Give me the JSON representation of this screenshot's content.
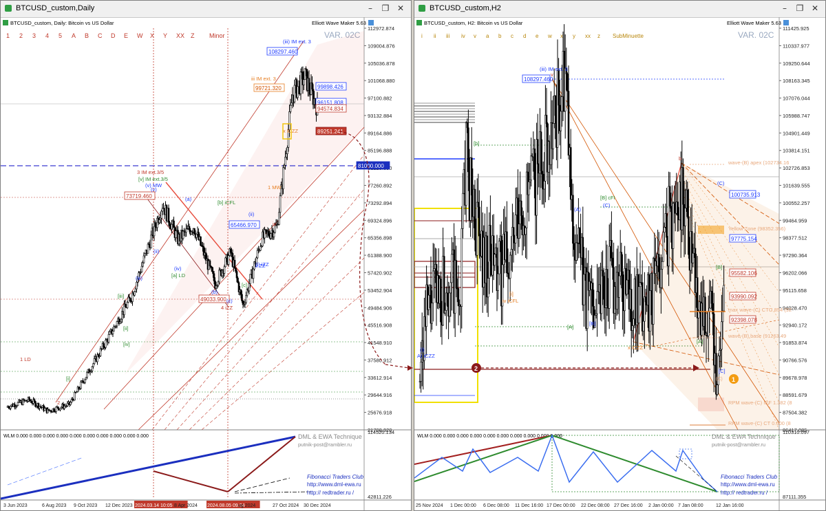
{
  "left": {
    "title": "BTCUSD_custom,Daily",
    "header": "BTCUSD_custom, Daily:  Bitcoin vs US Dollar",
    "plugin": "Elliott Wave Maker 5.63",
    "var_label": "VAR. 02C",
    "degree_labels": [
      "1",
      "2",
      "3",
      "4",
      "5",
      "A",
      "B",
      "C",
      "D",
      "E",
      "W",
      "X",
      "Y",
      "XX",
      "Z"
    ],
    "degree_name": "Minor",
    "price_scale": [
      "112972.874",
      "109004.876",
      "105036.878",
      "101068.880",
      "97100.882",
      "93132.884",
      "89164.886",
      "85196.888",
      "81228.890",
      "77260.892",
      "73292.894",
      "69324.896",
      "65356.898",
      "61388.900",
      "57420.902",
      "53452.904",
      "49484.906",
      "45516.908",
      "41548.910",
      "37580.912",
      "33612.914",
      "29644.916",
      "25676.918",
      "21708.920"
    ],
    "time_axis": [
      "3 Jun 2023",
      "6 Aug 2023",
      "9 Oct 2023",
      "12 Dec 2023",
      "2024.03.14 10:05",
      "8 Apr 2024",
      "2024.08.05 09:24",
      "ug 2024",
      "27 Oct 2024",
      "30 Dec 2024"
    ],
    "price_tags": [
      {
        "text": "108297.460",
        "style": "blue"
      },
      {
        "text": "99721.320",
        "style": "orange"
      },
      {
        "text": "99898.426",
        "style": "blue"
      },
      {
        "text": "96151.808",
        "style": "blue"
      },
      {
        "text": "94574.834",
        "style": "red"
      },
      {
        "text": "89251.241",
        "style": "redfill"
      },
      {
        "text": "81000.000",
        "style": "bluefill"
      },
      {
        "text": "73719.460",
        "style": "red"
      },
      {
        "text": "65466.970",
        "style": "blue"
      },
      {
        "text": "49033.900",
        "style": "red"
      }
    ],
    "wave_labels": [
      "(iii) IM ext. 3",
      "iii IM ext. 3",
      "3 IM ext.3/5",
      "[v] IM ext.3/5",
      "(v) MW",
      "[a] LD",
      "4 iZZ",
      "1 LD",
      "2",
      "[iv]",
      "[iii]",
      "[ii]",
      "(iii)",
      "(v)",
      "(ii)",
      "(iv)",
      "(a)",
      "(b)",
      "(c)",
      "[b] iCFL",
      "(ii)",
      "ii ZZ",
      "(i) iZZ",
      "x iCZZ",
      "[c]",
      "[i]",
      "1 MW",
      "iv"
    ],
    "indicator": {
      "header": "WLM 0.000 0.000 0.000 0.000 0.000 0.000 0.000 0.000 0.000 0.000",
      "scale_top": "114520.134",
      "scale_bottom": "42811.226",
      "watermark": [
        "DML & EWA Technique",
        "putnik-post@rambler.ru",
        "Fibonacci Traders Club",
        "http://www.dml-ewa.ru",
        "http:// redtrader.ru /"
      ]
    },
    "markers": [
      "2"
    ]
  },
  "right": {
    "title": "BTCUSD_custom,H2",
    "header": "BTCUSD_custom, H2:  Bitcoin vs US Dollar",
    "plugin": "Elliott Wave Maker 5.63",
    "var_label": "VAR. 02C",
    "degree_labels": [
      "i",
      "ii",
      "iii",
      "iv",
      "v",
      "a",
      "b",
      "c",
      "d",
      "e",
      "w",
      "x",
      "y",
      "xx",
      "z"
    ],
    "degree_name": "SubMinuette",
    "price_scale": [
      "111425.925",
      "110337.977",
      "109250.644",
      "108163.345",
      "107076.044",
      "105988.747",
      "104901.449",
      "103814.151",
      "102726.853",
      "101639.555",
      "100552.257",
      "99464.959",
      "98377.512",
      "97290.364",
      "96202.066",
      "95115.658",
      "94028.470",
      "92940.172",
      "91853.874",
      "90766.576",
      "89678.978",
      "88591.679",
      "87504.382",
      "86417.085"
    ],
    "time_axis": [
      "25 Nov 2024",
      "1 Dec 00:00",
      "6 Dec 08:00",
      "11 Dec 16:00",
      "17 Dec 00:00",
      "22 Dec 08:00",
      "27 Dec 16:00",
      "2 Jan 00:00",
      "7 Jan 08:00",
      "12 Jan 16:00"
    ],
    "price_tags": [
      {
        "text": "108297.460",
        "style": "blue"
      },
      {
        "text": "100735.913",
        "style": "bluebox"
      },
      {
        "text": "97775.154",
        "style": "bluebox"
      },
      {
        "text": "95582.106",
        "style": "red"
      },
      {
        "text": "93990.092",
        "style": "red"
      },
      {
        "text": "92398.078",
        "style": "red"
      }
    ],
    "zone_labels": [
      "wave-(B) apex (102734.16",
      "Yellow Zone (98352.356)",
      "max wave-(C) CTG 854 (92",
      "wave-(B) base (91263.49",
      "",
      "RPM wave-(C) IEF 1.382 (8",
      "RPM wave-(C) CT 0.500 (8"
    ],
    "wave_labels": [
      "(iii) IM ext. 3",
      "v",
      "[b]",
      "[i]",
      "iv iCFL",
      "(A)",
      "[A]",
      "[B]",
      "[B] cFI",
      "(C)",
      "x iCZZ",
      "b",
      "(C)",
      "[A]",
      "[B]",
      "[C]",
      "A) iCZZ",
      "(i)"
    ],
    "indicator": {
      "header": "WLM 0.000 0.000 0.000 0.000 0.000 0.000 0.000 0.000 0.000 0.000",
      "scale_top": "110310.097",
      "scale_bottom": "87111.355",
      "watermark": [
        "DML & EWA Technique",
        "putnik-post@rambler.ru",
        "Fibonacci Traders Club",
        "http://www.dml-ewa.ru",
        "http:// redtrader.ru /"
      ]
    },
    "markers": [
      "1"
    ]
  },
  "colors": {
    "bull": "#111111",
    "red_line": "#c0392b",
    "orange": "#e67e22",
    "blue": "#1f3cff",
    "green": "#2e8b2e",
    "dark_red": "#8b1a1a",
    "navy": "#1b2fbf"
  },
  "chart_data": [
    {
      "type": "line",
      "title": "BTCUSD_custom, Daily: Bitcoin vs US Dollar",
      "xlabel": "",
      "ylabel": "",
      "ylim": [
        21708.92,
        112972.874
      ],
      "x": [
        "3 Jun 2023",
        "6 Aug 2023",
        "9 Oct 2023",
        "12 Dec 2023",
        "2024.03.14 10:05",
        "8 Apr 2024",
        "2024.08.05 09:24",
        "27 Oct 2024",
        "30 Dec 2024"
      ],
      "series": [
        {
          "values": [
            27000,
            29000,
            27500,
            42000,
            73000,
            69000,
            49500,
            67000,
            95000
          ]
        }
      ]
    },
    {
      "type": "line",
      "title": "BTCUSD_custom, H2: Bitcoin vs US Dollar",
      "xlabel": "",
      "ylabel": "",
      "ylim": [
        86417.085,
        111425.925
      ],
      "x": [
        "25 Nov 2024",
        "1 Dec 00:00",
        "6 Dec 08:00",
        "11 Dec 16:00",
        "17 Dec 00:00",
        "22 Dec 08:00",
        "27 Dec 16:00",
        "2 Jan 00:00",
        "7 Jan 08:00",
        "12 Jan 16:00"
      ],
      "series": [
        {
          "values": [
            92500,
            96000,
            99500,
            101000,
            107500,
            95500,
            93500,
            98500,
            96000,
            90000
          ]
        }
      ]
    }
  ]
}
